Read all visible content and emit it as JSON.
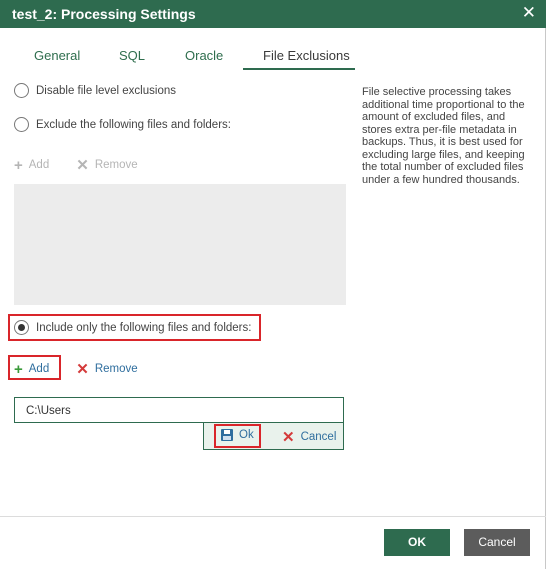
{
  "window": {
    "title": "test_2: Processing Settings",
    "close_glyph": "✕"
  },
  "tabs": [
    {
      "label": "General"
    },
    {
      "label": "SQL"
    },
    {
      "label": "Oracle"
    },
    {
      "label": "File Exclusions",
      "active": true
    }
  ],
  "options": {
    "disable_label": "Disable file level exclusions",
    "exclude_label": "Exclude the following files and folders:",
    "include_label": "Include only the following files and folders:",
    "selected": "include"
  },
  "exclude_toolbar": {
    "add_label": "Add",
    "remove_label": "Remove"
  },
  "include_toolbar": {
    "add_label": "Add",
    "remove_label": "Remove"
  },
  "include_list": {
    "edit_value": "C:\\Users"
  },
  "edit_actions": {
    "ok_label": "Ok",
    "cancel_label": "Cancel"
  },
  "info_text": "File selective processing takes additional time proportional to the amount of excluded files, and stores extra per-file metadata in backups. Thus, it is best used for excluding large files, and keeping the total number of excluded files under a few hundred thousands.",
  "footer": {
    "ok_label": "OK",
    "cancel_label": "Cancel"
  },
  "icons": {
    "add": "plus-icon",
    "remove": "x-icon",
    "save": "floppy-icon"
  },
  "colors": {
    "titlebar": "#2e6b4f",
    "accent": "#2e6b4f",
    "highlight": "#d9252a",
    "add_green": "#3a9a3a",
    "remove_red": "#d43a3a"
  }
}
